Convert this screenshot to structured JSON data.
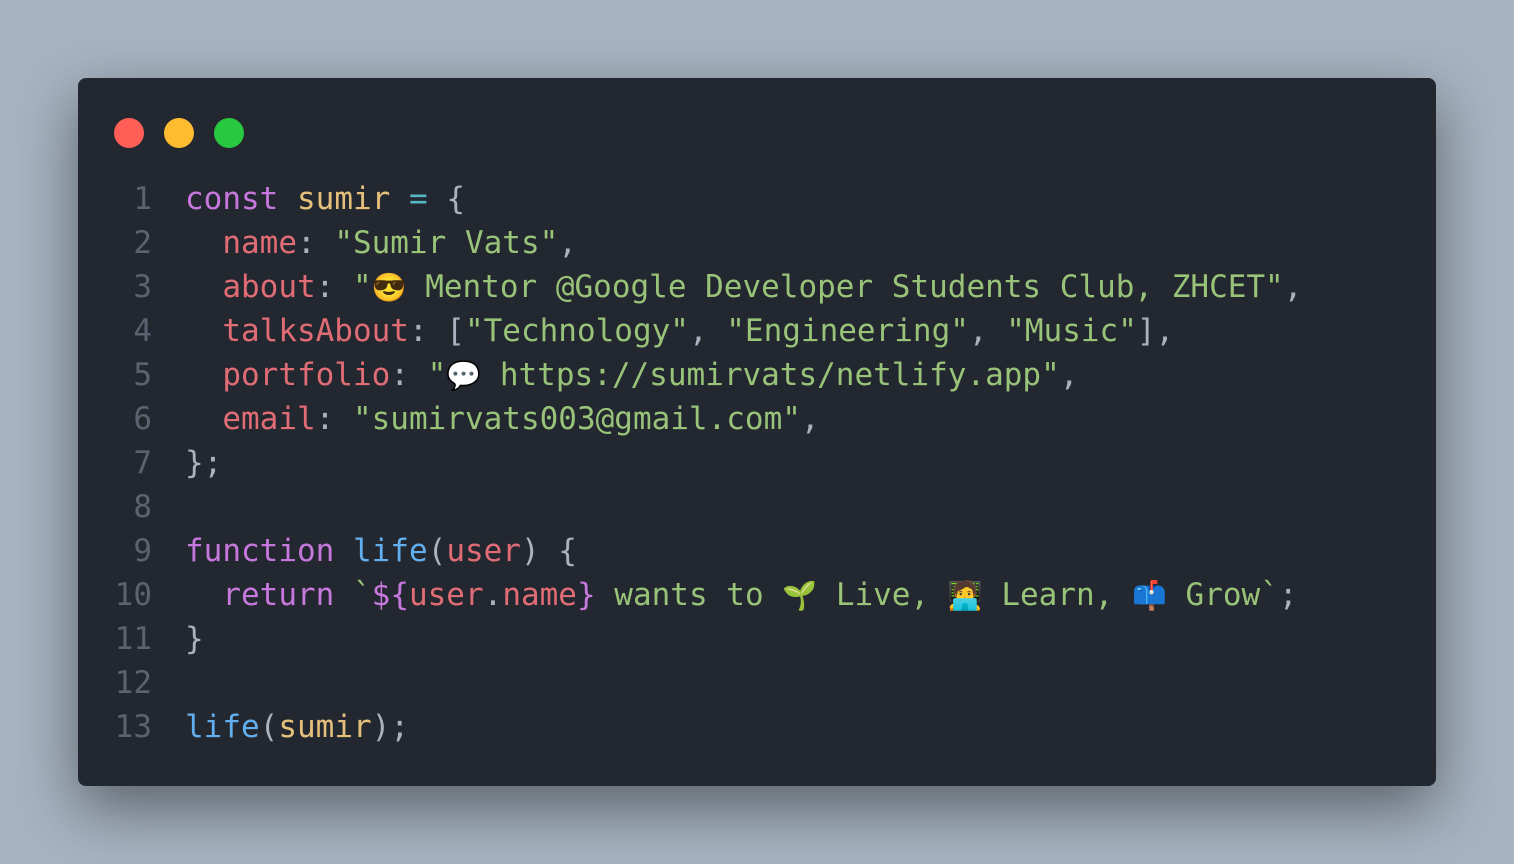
{
  "colors": {
    "background": "#a6b3c0",
    "window": "#23272f",
    "line_number": "#5b6270",
    "dot_red": "#ff5f57",
    "dot_yellow": "#febc2e",
    "dot_green": "#28c840"
  },
  "code_lines": [
    {
      "n": "1",
      "tokens": [
        {
          "t": "const",
          "c": "#c678dd"
        },
        {
          "t": " ",
          "c": "#abb2bf"
        },
        {
          "t": "sumir",
          "c": "#e5c07b"
        },
        {
          "t": " ",
          "c": "#abb2bf"
        },
        {
          "t": "=",
          "c": "#56b6c2"
        },
        {
          "t": " {",
          "c": "#abb2bf"
        }
      ]
    },
    {
      "n": "2",
      "tokens": [
        {
          "t": "  ",
          "c": "#abb2bf"
        },
        {
          "t": "name",
          "c": "#e06c75"
        },
        {
          "t": ": ",
          "c": "#abb2bf"
        },
        {
          "t": "\"Sumir Vats\"",
          "c": "#98c379"
        },
        {
          "t": ",",
          "c": "#abb2bf"
        }
      ]
    },
    {
      "n": "3",
      "tokens": [
        {
          "t": "  ",
          "c": "#abb2bf"
        },
        {
          "t": "about",
          "c": "#e06c75"
        },
        {
          "t": ": ",
          "c": "#abb2bf"
        },
        {
          "t": "\"",
          "c": "#98c379"
        },
        {
          "t": "😎",
          "c": "#ffcc4d",
          "emoji": true
        },
        {
          "t": " Mentor @Google Developer Students Club, ZHCET\"",
          "c": "#98c379"
        },
        {
          "t": ",",
          "c": "#abb2bf"
        }
      ]
    },
    {
      "n": "4",
      "tokens": [
        {
          "t": "  ",
          "c": "#abb2bf"
        },
        {
          "t": "talksAbout",
          "c": "#e06c75"
        },
        {
          "t": ": [",
          "c": "#abb2bf"
        },
        {
          "t": "\"Technology\"",
          "c": "#98c379"
        },
        {
          "t": ", ",
          "c": "#abb2bf"
        },
        {
          "t": "\"Engineering\"",
          "c": "#98c379"
        },
        {
          "t": ", ",
          "c": "#abb2bf"
        },
        {
          "t": "\"Music\"",
          "c": "#98c379"
        },
        {
          "t": "],",
          "c": "#abb2bf"
        }
      ]
    },
    {
      "n": "5",
      "tokens": [
        {
          "t": "  ",
          "c": "#abb2bf"
        },
        {
          "t": "portfolio",
          "c": "#e06c75"
        },
        {
          "t": ": ",
          "c": "#abb2bf"
        },
        {
          "t": "\"",
          "c": "#98c379"
        },
        {
          "t": "💬",
          "c": "#ffffff",
          "emoji": true
        },
        {
          "t": " https://sumirvats/netlify.app\"",
          "c": "#98c379"
        },
        {
          "t": ",",
          "c": "#abb2bf"
        }
      ]
    },
    {
      "n": "6",
      "tokens": [
        {
          "t": "  ",
          "c": "#abb2bf"
        },
        {
          "t": "email",
          "c": "#e06c75"
        },
        {
          "t": ": ",
          "c": "#abb2bf"
        },
        {
          "t": "\"sumirvats003@gmail.com\"",
          "c": "#98c379"
        },
        {
          "t": ",",
          "c": "#abb2bf"
        }
      ]
    },
    {
      "n": "7",
      "tokens": [
        {
          "t": "};",
          "c": "#abb2bf"
        }
      ]
    },
    {
      "n": "8",
      "tokens": []
    },
    {
      "n": "9",
      "tokens": [
        {
          "t": "function",
          "c": "#c678dd"
        },
        {
          "t": " ",
          "c": "#abb2bf"
        },
        {
          "t": "life",
          "c": "#61afef"
        },
        {
          "t": "(",
          "c": "#abb2bf"
        },
        {
          "t": "user",
          "c": "#e06c75"
        },
        {
          "t": ") {",
          "c": "#abb2bf"
        }
      ]
    },
    {
      "n": "10",
      "tokens": [
        {
          "t": "  ",
          "c": "#abb2bf"
        },
        {
          "t": "return",
          "c": "#c678dd"
        },
        {
          "t": " ",
          "c": "#abb2bf"
        },
        {
          "t": "`",
          "c": "#98c379"
        },
        {
          "t": "${",
          "c": "#c678dd"
        },
        {
          "t": "user",
          "c": "#e06c75"
        },
        {
          "t": ".",
          "c": "#abb2bf"
        },
        {
          "t": "name",
          "c": "#e06c75"
        },
        {
          "t": "}",
          "c": "#c678dd"
        },
        {
          "t": " wants to ",
          "c": "#98c379"
        },
        {
          "t": "🌱",
          "c": "#77b255",
          "emoji": true
        },
        {
          "t": " Live, ",
          "c": "#98c379"
        },
        {
          "t": "🧑‍💻",
          "c": "#ffcc4d",
          "emoji": true
        },
        {
          "t": " Learn, ",
          "c": "#98c379"
        },
        {
          "t": "📫",
          "c": "#5c91ea",
          "emoji": true
        },
        {
          "t": " Grow`",
          "c": "#98c379"
        },
        {
          "t": ";",
          "c": "#abb2bf"
        }
      ]
    },
    {
      "n": "11",
      "tokens": [
        {
          "t": "}",
          "c": "#abb2bf"
        }
      ]
    },
    {
      "n": "12",
      "tokens": []
    },
    {
      "n": "13",
      "tokens": [
        {
          "t": "life",
          "c": "#61afef"
        },
        {
          "t": "(",
          "c": "#abb2bf"
        },
        {
          "t": "sumir",
          "c": "#e5c07b"
        },
        {
          "t": ");",
          "c": "#abb2bf"
        }
      ]
    }
  ]
}
